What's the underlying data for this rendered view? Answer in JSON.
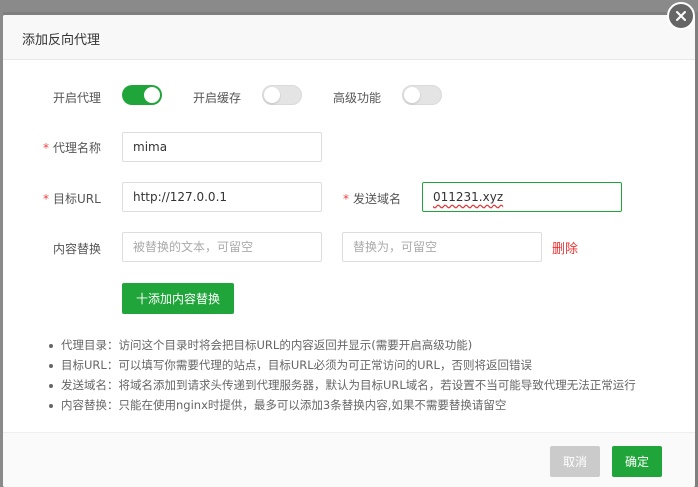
{
  "dialog": {
    "title": "添加反向代理"
  },
  "toggles": {
    "proxy": {
      "label": "开启代理",
      "on": true
    },
    "cache": {
      "label": "开启缓存",
      "on": false
    },
    "advanced": {
      "label": "高级功能",
      "on": false
    }
  },
  "fields": {
    "proxy_name": {
      "label": "代理名称",
      "value": "mima"
    },
    "target_url": {
      "label": "目标URL",
      "value": "http://127.0.0.1"
    },
    "send_domain": {
      "label": "发送域名",
      "value": "011231.xyz"
    },
    "content_replace": {
      "label": "内容替换",
      "from_placeholder": "被替换的文本，可留空",
      "to_placeholder": "替换为，可留空",
      "delete_label": "删除"
    }
  },
  "add_replace_button": "十添加内容替换",
  "notes": [
    "代理目录：访问这个目录时将会把目标URL的内容返回并显示(需要开启高级功能)",
    "目标URL：可以填写你需要代理的站点，目标URL必须为可正常访问的URL，否则将返回错误",
    "发送域名：将域名添加到请求头传递到代理服务器，默认为目标URL域名，若设置不当可能导致代理无法正常运行",
    "内容替换：只能在使用nginx时提供，最多可以添加3条替换内容,如果不需要替换请留空"
  ],
  "footer": {
    "cancel_label": "取消",
    "confirm_label": "确定"
  },
  "colors": {
    "accent": "#20a53a",
    "danger": "#ee3333"
  }
}
